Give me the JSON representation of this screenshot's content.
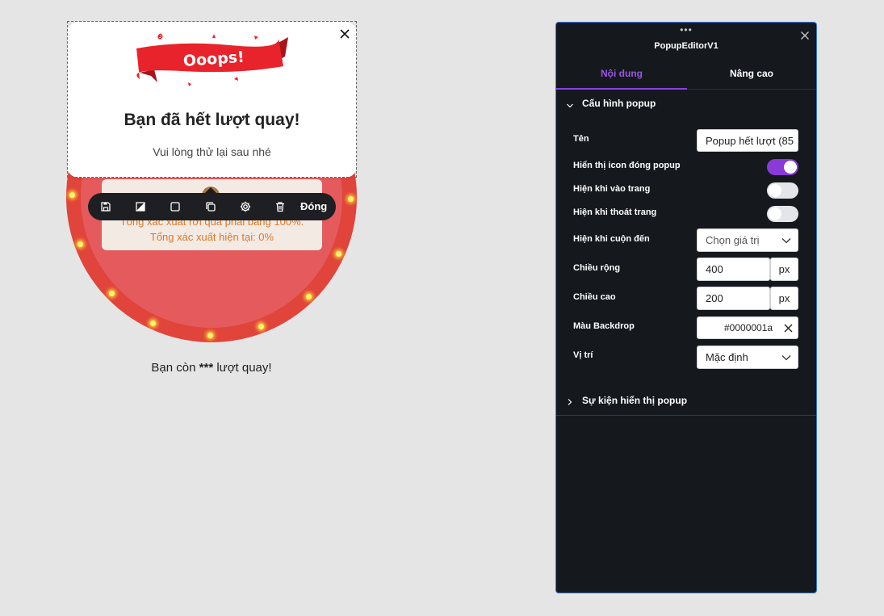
{
  "popup": {
    "badge_text": "Ooops!",
    "title": "Bạn đã hết lượt quay!",
    "subtitle": "Vui lòng thử lại sau nhé"
  },
  "wheel": {
    "info_line_1": "Tổng xác xuất rơi quà phải bằng 100%.",
    "info_line_2": "Tổng xác xuất hiện tại: 0%",
    "spin_prefix": "Bạn còn ",
    "spin_count": "***",
    "spin_suffix": " lượt quay!"
  },
  "toolbar": {
    "close_label": "Đóng",
    "icons": [
      "save-icon",
      "contrast-icon",
      "square-icon",
      "duplicate-icon",
      "gear-icon",
      "trash-icon"
    ]
  },
  "panel": {
    "grip": "•••",
    "title": "PopupEditorV1",
    "tabs": [
      {
        "label": "Nội dung",
        "active": true
      },
      {
        "label": "Nâng cao",
        "active": false
      }
    ],
    "section_config": "Cấu hình popup",
    "section_events": "Sự kiện hiển thị popup",
    "fields": {
      "name_label": "Tên",
      "name_value": "Popup hết lượt (85",
      "show_close_icon_label": "Hiển thị icon đóng popup",
      "show_close_icon": true,
      "show_on_enter_label": "Hiện khi vào trang",
      "show_on_enter": false,
      "show_on_exit_label": "Hiện khi thoát trang",
      "show_on_exit": false,
      "show_on_scroll_label": "Hiện khi cuộn đến",
      "show_on_scroll_value": "Chọn giá trị",
      "width_label": "Chiều rộng",
      "width_value": "400",
      "width_unit": "px",
      "height_label": "Chiều cao",
      "height_value": "200",
      "height_unit": "px",
      "backdrop_label": "Màu Backdrop",
      "backdrop_value": "#0000001a",
      "position_label": "Vị trí",
      "position_value": "Mặc định"
    }
  },
  "colors": {
    "accent": "#8a3ad6",
    "panel_bg": "#15181d",
    "panel_border": "#2f78d8",
    "wheel_red": "#e0443a",
    "ribbon_red": "#e8232b"
  }
}
